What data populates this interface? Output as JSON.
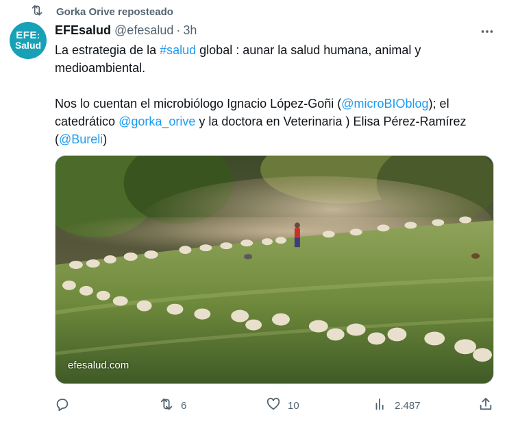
{
  "repost": {
    "label": "Gorka Orive reposteado",
    "icon": "repost-icon"
  },
  "avatar": {
    "line1": "EFE",
    "line2": "Salud",
    "color": "#16a1b7"
  },
  "tweet": {
    "author": "EFEsalud",
    "handle": "@efesalud",
    "separator": "·",
    "time": "3h",
    "p1_a": "La estrategia de la ",
    "p1_hashtag": "#salud",
    "p1_b": " global : aunar la salud humana, animal y medioambiental.",
    "p2_a": "Nos lo cuentan el microbiólogo Ignacio López-Goñi (",
    "p2_m1": "@microBIOblog",
    "p2_b": ");  el catedrático ",
    "p2_m2": "@gorka_orive",
    "p2_c": "  y la doctora en Veterinaria ) Elisa Pérez-Ramírez (",
    "p2_m3": "@Bureli",
    "p2_d": ")"
  },
  "media": {
    "caption": "efesalud.com"
  },
  "actions": {
    "reply_count": "",
    "repost_count": "6",
    "like_count": "10",
    "views_count": "2.487"
  },
  "colors": {
    "link": "#1d9bf0",
    "muted": "#536471",
    "text": "#0f1419"
  }
}
